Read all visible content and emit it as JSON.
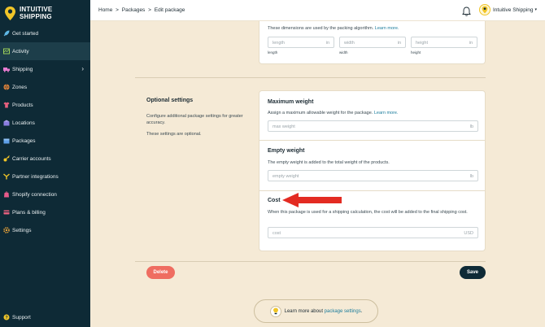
{
  "brand": {
    "logo_line1": "INTUITIVE",
    "logo_line2": "SHIPPING",
    "accent": "#f0c528"
  },
  "sidebar": {
    "items": [
      {
        "label": "Get started",
        "icon": "rocket-icon"
      },
      {
        "label": "Activity",
        "icon": "activity-icon"
      },
      {
        "label": "Shipping",
        "icon": "shipping-icon",
        "has_submenu": true
      },
      {
        "label": "Zones",
        "icon": "globe-icon"
      },
      {
        "label": "Products",
        "icon": "shirt-icon"
      },
      {
        "label": "Locations",
        "icon": "location-icon"
      },
      {
        "label": "Packages",
        "icon": "package-icon"
      },
      {
        "label": "Carrier accounts",
        "icon": "key-icon"
      },
      {
        "label": "Partner integrations",
        "icon": "integrations-icon"
      },
      {
        "label": "Shopify connection",
        "icon": "shopify-icon"
      },
      {
        "label": "Plans & billing",
        "icon": "billing-icon"
      },
      {
        "label": "Settings",
        "icon": "gear-icon"
      }
    ],
    "active_index": 1,
    "support_label": "Support"
  },
  "header": {
    "breadcrumb": [
      "Home",
      ">",
      "Packages",
      ">",
      "Edit package"
    ],
    "account_label": "Intuitive Shipping"
  },
  "dimensions": {
    "help": "These dimensions are used by the packing algorithm.",
    "help_link": "Learn more.",
    "fields": [
      {
        "placeholder": "length",
        "suffix": "in",
        "label": "length"
      },
      {
        "placeholder": "width",
        "suffix": "in",
        "label": "width"
      },
      {
        "placeholder": "height",
        "suffix": "in",
        "label": "height"
      }
    ]
  },
  "optional": {
    "title": "Optional settings",
    "description": "Configure additional package settings for greater accuracy.",
    "note": "These settings are optional.",
    "max_weight": {
      "title": "Maximum weight",
      "help": "Assign a maximum allowable weight for the package.",
      "help_link": "Learn more.",
      "placeholder": "max weight",
      "suffix": "lb"
    },
    "empty_weight": {
      "title": "Empty weight",
      "help": "The empty weight is added to the total weight of the products.",
      "placeholder": "empty weight",
      "suffix": "lb"
    },
    "cost": {
      "title": "Cost",
      "help": "When this package is used for a shipping calculation, the cost will be added to the final shipping cost.",
      "placeholder": "cost",
      "suffix": "USD"
    }
  },
  "actions": {
    "delete_label": "Delete",
    "save_label": "Save"
  },
  "learn_more": {
    "prefix": "Learn more about",
    "link": "package settings",
    "suffix": "."
  }
}
